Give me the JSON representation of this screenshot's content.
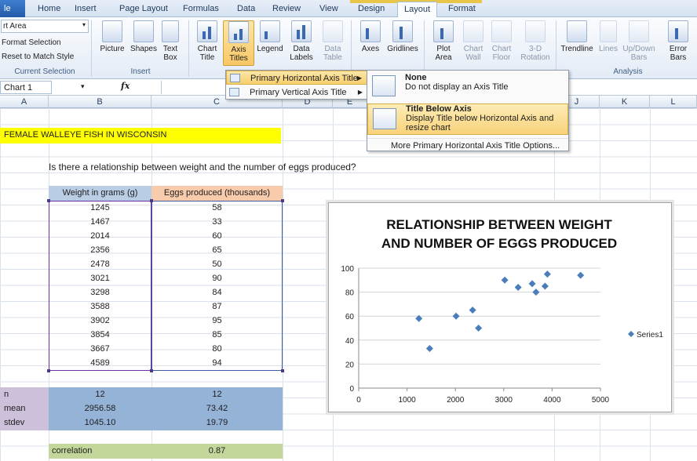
{
  "tabs": {
    "file": "le",
    "home": "Home",
    "insert": "Insert",
    "page_layout": "Page Layout",
    "formulas": "Formulas",
    "data": "Data",
    "review": "Review",
    "view": "View",
    "design": "Design",
    "layout": "Layout",
    "format": "Format"
  },
  "ribbon": {
    "selection_box": "rt Area",
    "format_selection": "Format Selection",
    "reset_style": "Reset to Match Style",
    "group_current_selection": "Current Selection",
    "group_insert": "Insert",
    "group_analysis": "Analysis",
    "buttons": {
      "picture": "Picture",
      "shapes": "Shapes",
      "text_box": "Text Box",
      "chart_title": "Chart Title",
      "axis_titles": "Axis Titles",
      "legend": "Legend",
      "data_labels": "Data Labels",
      "data_table": "Data Table",
      "axes": "Axes",
      "gridlines": "Gridlines",
      "plot_area": "Plot Area",
      "chart_wall": "Chart Wall",
      "chart_floor": "Chart Floor",
      "rotation": "3-D Rotation",
      "trendline": "Trendline",
      "lines": "Lines",
      "updown_bars": "Up/Down Bars",
      "error_bars": "Error Bars"
    }
  },
  "formula_bar": {
    "name_box": "Chart 1",
    "fx": "fx"
  },
  "columns": [
    "A",
    "B",
    "C",
    "D",
    "E",
    "J",
    "K",
    "L"
  ],
  "sheet": {
    "title": "FEMALE WALLEYE FISH IN WISCONSIN",
    "question": "Is there a relationship between weight and the number of eggs produced?",
    "header_weight": "Weight in grams (g)",
    "header_eggs": "Eggs produced (thousands)",
    "rows": [
      {
        "w": "1245",
        "e": "58"
      },
      {
        "w": "1467",
        "e": "33"
      },
      {
        "w": "2014",
        "e": "60"
      },
      {
        "w": "2356",
        "e": "65"
      },
      {
        "w": "2478",
        "e": "50"
      },
      {
        "w": "3021",
        "e": "90"
      },
      {
        "w": "3298",
        "e": "84"
      },
      {
        "w": "3588",
        "e": "87"
      },
      {
        "w": "3902",
        "e": "95"
      },
      {
        "w": "3854",
        "e": "85"
      },
      {
        "w": "3667",
        "e": "80"
      },
      {
        "w": "4589",
        "e": "94"
      }
    ],
    "stats": {
      "n_label": "n",
      "n_w": "12",
      "n_e": "12",
      "mean_label": "mean",
      "mean_w": "2956.58",
      "mean_e": "73.42",
      "stdev_label": "stdev",
      "stdev_w": "1045.10",
      "stdev_e": "19.79"
    },
    "correlation_label": "correlation",
    "correlation_value": "0.87"
  },
  "menu_axis_titles": {
    "primary_horizontal": "Primary Horizontal Axis Title",
    "primary_vertical": "Primary Vertical Axis Title"
  },
  "menu_horizontal": {
    "none_title": "None",
    "none_desc": "Do not display an Axis Title",
    "below_title": "Title Below Axis",
    "below_desc_1": "Display Title below Horizontal Axis and",
    "below_desc_2": "resize chart",
    "more": "More Primary Horizontal Axis Title Options..."
  },
  "colors": {
    "title_band": "#ffff00",
    "header_weight_bg": "#b9cde5",
    "header_eggs_bg": "#f8cbad",
    "stat_label_bg": "#ccc0da",
    "stat_value_bg": "#95b3d7",
    "correlation_bg": "#c4d79b",
    "series": "#4a7ebb"
  },
  "chart_data": {
    "type": "scatter",
    "title_line1": "RELATIONSHIP BETWEEN WEIGHT",
    "title_line2": "AND NUMBER OF EGGS PRODUCED",
    "xlim": [
      0,
      5000
    ],
    "ylim": [
      0,
      100
    ],
    "xticks": [
      0,
      1000,
      2000,
      3000,
      4000,
      5000
    ],
    "yticks": [
      0,
      20,
      40,
      60,
      80,
      100
    ],
    "grid": "horizontal",
    "legend_position": "right",
    "series": [
      {
        "name": "Series1",
        "points": [
          [
            1245,
            58
          ],
          [
            1467,
            33
          ],
          [
            2014,
            60
          ],
          [
            2356,
            65
          ],
          [
            2478,
            50
          ],
          [
            3021,
            90
          ],
          [
            3298,
            84
          ],
          [
            3588,
            87
          ],
          [
            3902,
            95
          ],
          [
            3854,
            85
          ],
          [
            3667,
            80
          ],
          [
            4589,
            94
          ]
        ]
      }
    ]
  }
}
